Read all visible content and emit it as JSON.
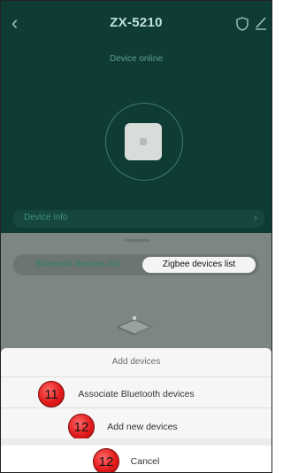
{
  "header": {
    "title": "ZX-5210",
    "status": "Device online"
  },
  "device_info": {
    "label": "Device info"
  },
  "tabs": [
    {
      "label": "Bluetooth devices list"
    },
    {
      "label": "Zigbee devices list"
    }
  ],
  "action_sheet": {
    "title": "Add devices",
    "items": [
      {
        "label": "Associate Bluetooth devices",
        "badge": "11"
      },
      {
        "label": "Add new devices",
        "badge": "12"
      }
    ],
    "cancel": {
      "label": "Cancel",
      "badge": "12"
    }
  },
  "colors": {
    "top_bg": "#0e3b33",
    "accent": "#2e7e6c",
    "badge_red": "#e31b1b"
  }
}
